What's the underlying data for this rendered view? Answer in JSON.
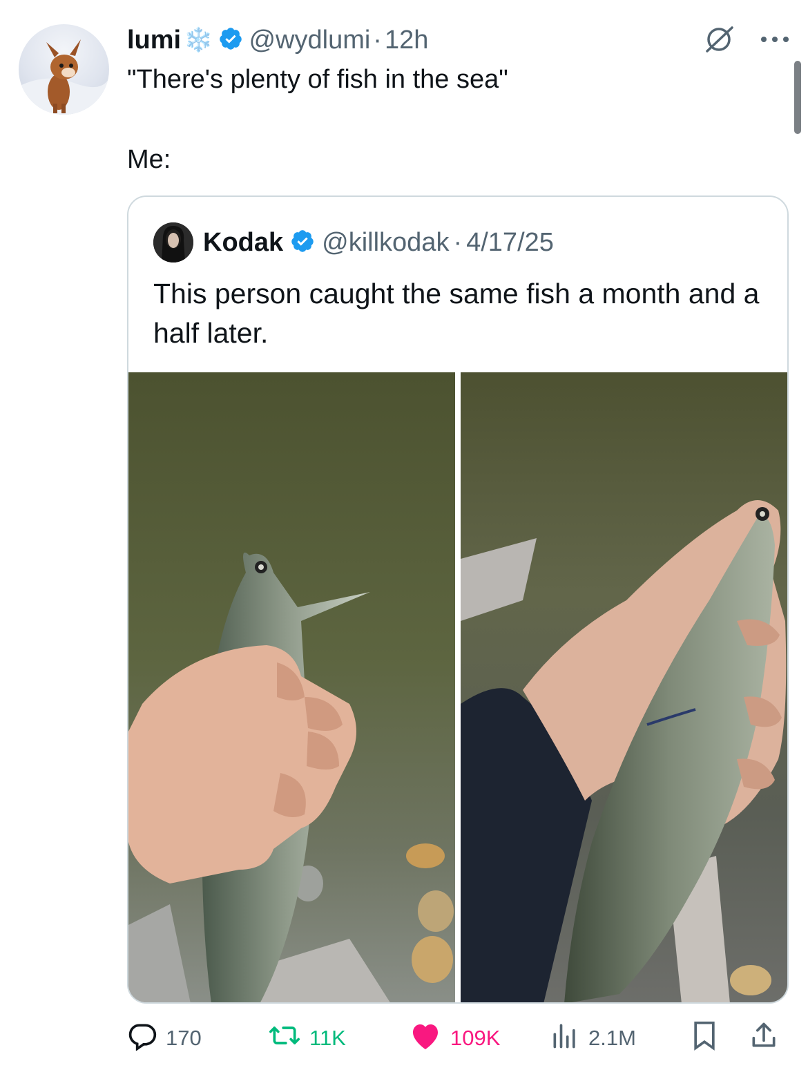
{
  "post": {
    "author_name": "lumi",
    "author_emoji": "❄️",
    "handle": "@wydlumi",
    "separator": "·",
    "time": "12h",
    "text_line1": "\"There's plenty of fish in the sea\"",
    "text_line2": "Me:"
  },
  "quoted": {
    "author_name": "Kodak",
    "handle": "@killkodak",
    "separator": "·",
    "date": "4/17/25",
    "text": "This person caught the same fish a month and a half later."
  },
  "actions": {
    "replies": "170",
    "reposts": "11K",
    "likes": "109K",
    "views": "2.1M"
  },
  "colors": {
    "verified": "#1d9bf0",
    "like": "#f91880",
    "muted": "#536471",
    "repost": "#00ba7c"
  },
  "icons": [
    "verified-badge-icon",
    "grok-icon",
    "more-icon",
    "reply-icon",
    "repost-icon",
    "like-icon",
    "views-icon",
    "bookmark-icon",
    "share-icon"
  ]
}
